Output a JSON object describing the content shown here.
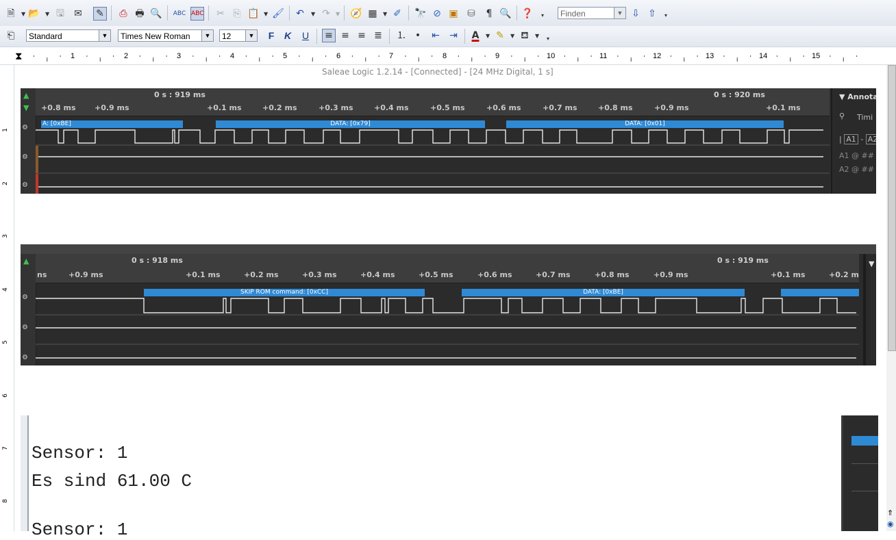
{
  "toolbar": {
    "find_value": "Finden",
    "icons": [
      "new-document-icon",
      "open-icon",
      "save-icon",
      "send-icon",
      "edit-mode-icon",
      "export-pdf-icon",
      "print-icon",
      "page-preview-icon",
      "spellcheck-icon",
      "autospell-icon",
      "cut-icon",
      "copy-icon",
      "paste-icon",
      "format-brush-icon",
      "undo-icon",
      "redo-icon",
      "navigator-icon",
      "table-icon",
      "draw-icon",
      "find-icon",
      "gallery-icon",
      "image-icon",
      "datasource-icon",
      "formatting-marks-icon",
      "zoom-icon",
      "help-icon",
      "find-down-icon",
      "find-up-icon"
    ]
  },
  "format": {
    "style": "Standard",
    "font": "Times New Roman",
    "size": "12",
    "bold": "F",
    "italic": "K",
    "underline": "U"
  },
  "ruler": {
    "numbers": [
      "1",
      "2",
      "3",
      "4",
      "5",
      "6",
      "7",
      "8",
      "9",
      "10",
      "11",
      "12",
      "13",
      "14",
      "15"
    ],
    "vertical": [
      "1",
      "2",
      "3",
      "4",
      "5",
      "6",
      "7",
      "8"
    ]
  },
  "logic_top": {
    "title": "Saleae Logic 1.2.14 - [Connected] - [24 MHz Digital, 1 s]",
    "time_header_left": "0 s : 919 ms",
    "time_header_right": "0 s : 920 ms",
    "tick_labels": [
      "+0.8 ms",
      "+0.9 ms",
      "+0.1 ms",
      "+0.2 ms",
      "+0.3 ms",
      "+0.4 ms",
      "+0.5 ms",
      "+0.6 ms",
      "+0.7 ms",
      "+0.8 ms",
      "+0.9 ms",
      "+0.1 ms"
    ],
    "decodes": [
      "A: [0xBE]",
      "DATA: [0x79]",
      "DATA: [0x01]"
    ],
    "annotation_title": "Annota",
    "annotation_timing": "Timi",
    "a1": "A1",
    "a2": "A2",
    "a1_at": "A1  @  ##",
    "a2_at": "A2  @  ##"
  },
  "logic_bottom": {
    "time_header_left": "0 s : 918 ms",
    "time_header_right": "0 s : 919 ms",
    "tick_labels": [
      "ns",
      "+0.9 ms",
      "+0.1 ms",
      "+0.2 ms",
      "+0.3 ms",
      "+0.4 ms",
      "+0.5 ms",
      "+0.6 ms",
      "+0.7 ms",
      "+0.8 ms",
      "+0.9 ms",
      "+0.1 ms",
      "+0.2 m"
    ],
    "decodes": [
      "SKIP ROM command: [0xCC]",
      "DATA: [0xBE]"
    ]
  },
  "terminal": {
    "line1": "Sensor: 1",
    "line2": "Es sind 61.00 C"
  }
}
